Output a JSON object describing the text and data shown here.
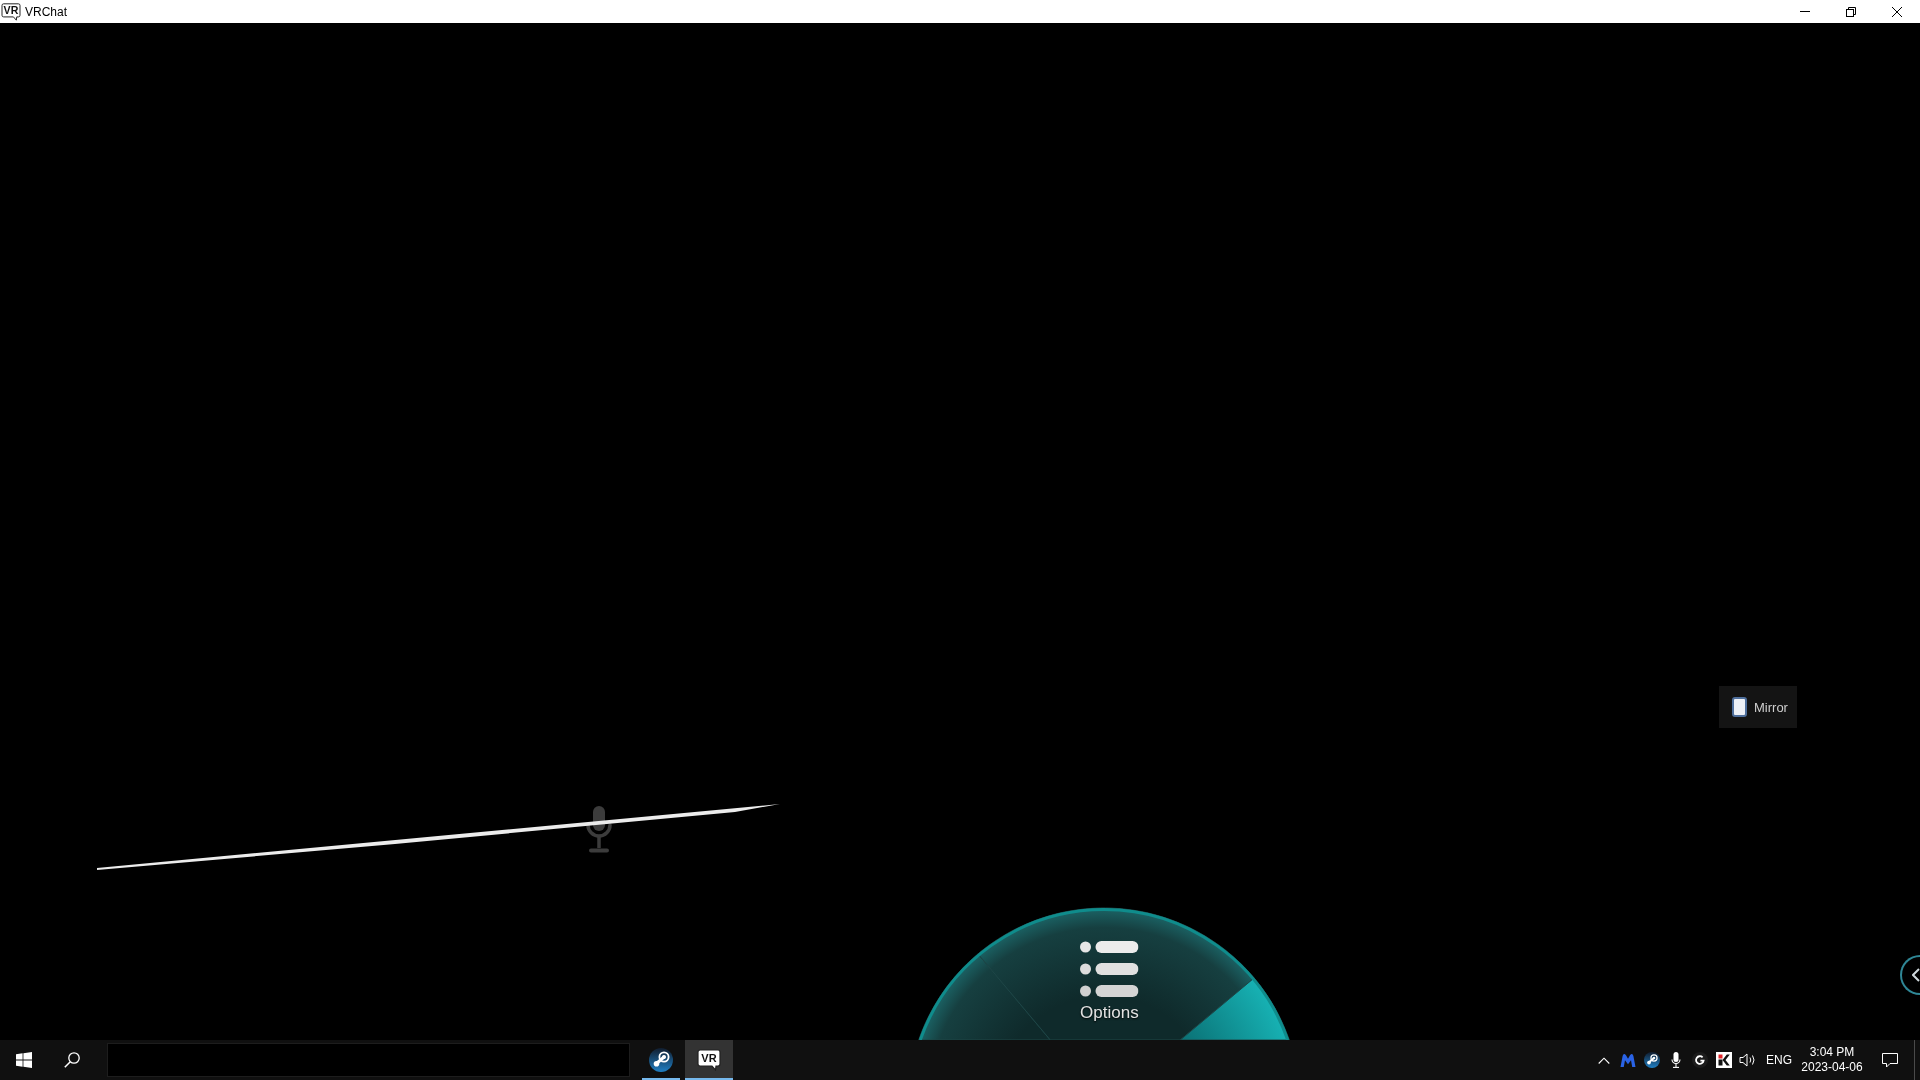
{
  "window": {
    "icon_text": "VR",
    "title": "VRChat"
  },
  "game_view": {
    "mirror_toggle": {
      "label": "Mirror",
      "checked": false
    },
    "radial_menu": {
      "sectors": [
        {
          "selected": false
        },
        {
          "label": "Options",
          "selected": false
        },
        {
          "selected": true
        }
      ]
    }
  },
  "taskbar": {
    "apps": [
      {
        "kind": "steam",
        "selected": false
      },
      {
        "kind": "vrchat",
        "icon_text": "VR",
        "selected": true
      }
    ],
    "tray": {
      "language": "ENG",
      "time": "3:04 PM",
      "date": "2023-04-06"
    }
  }
}
